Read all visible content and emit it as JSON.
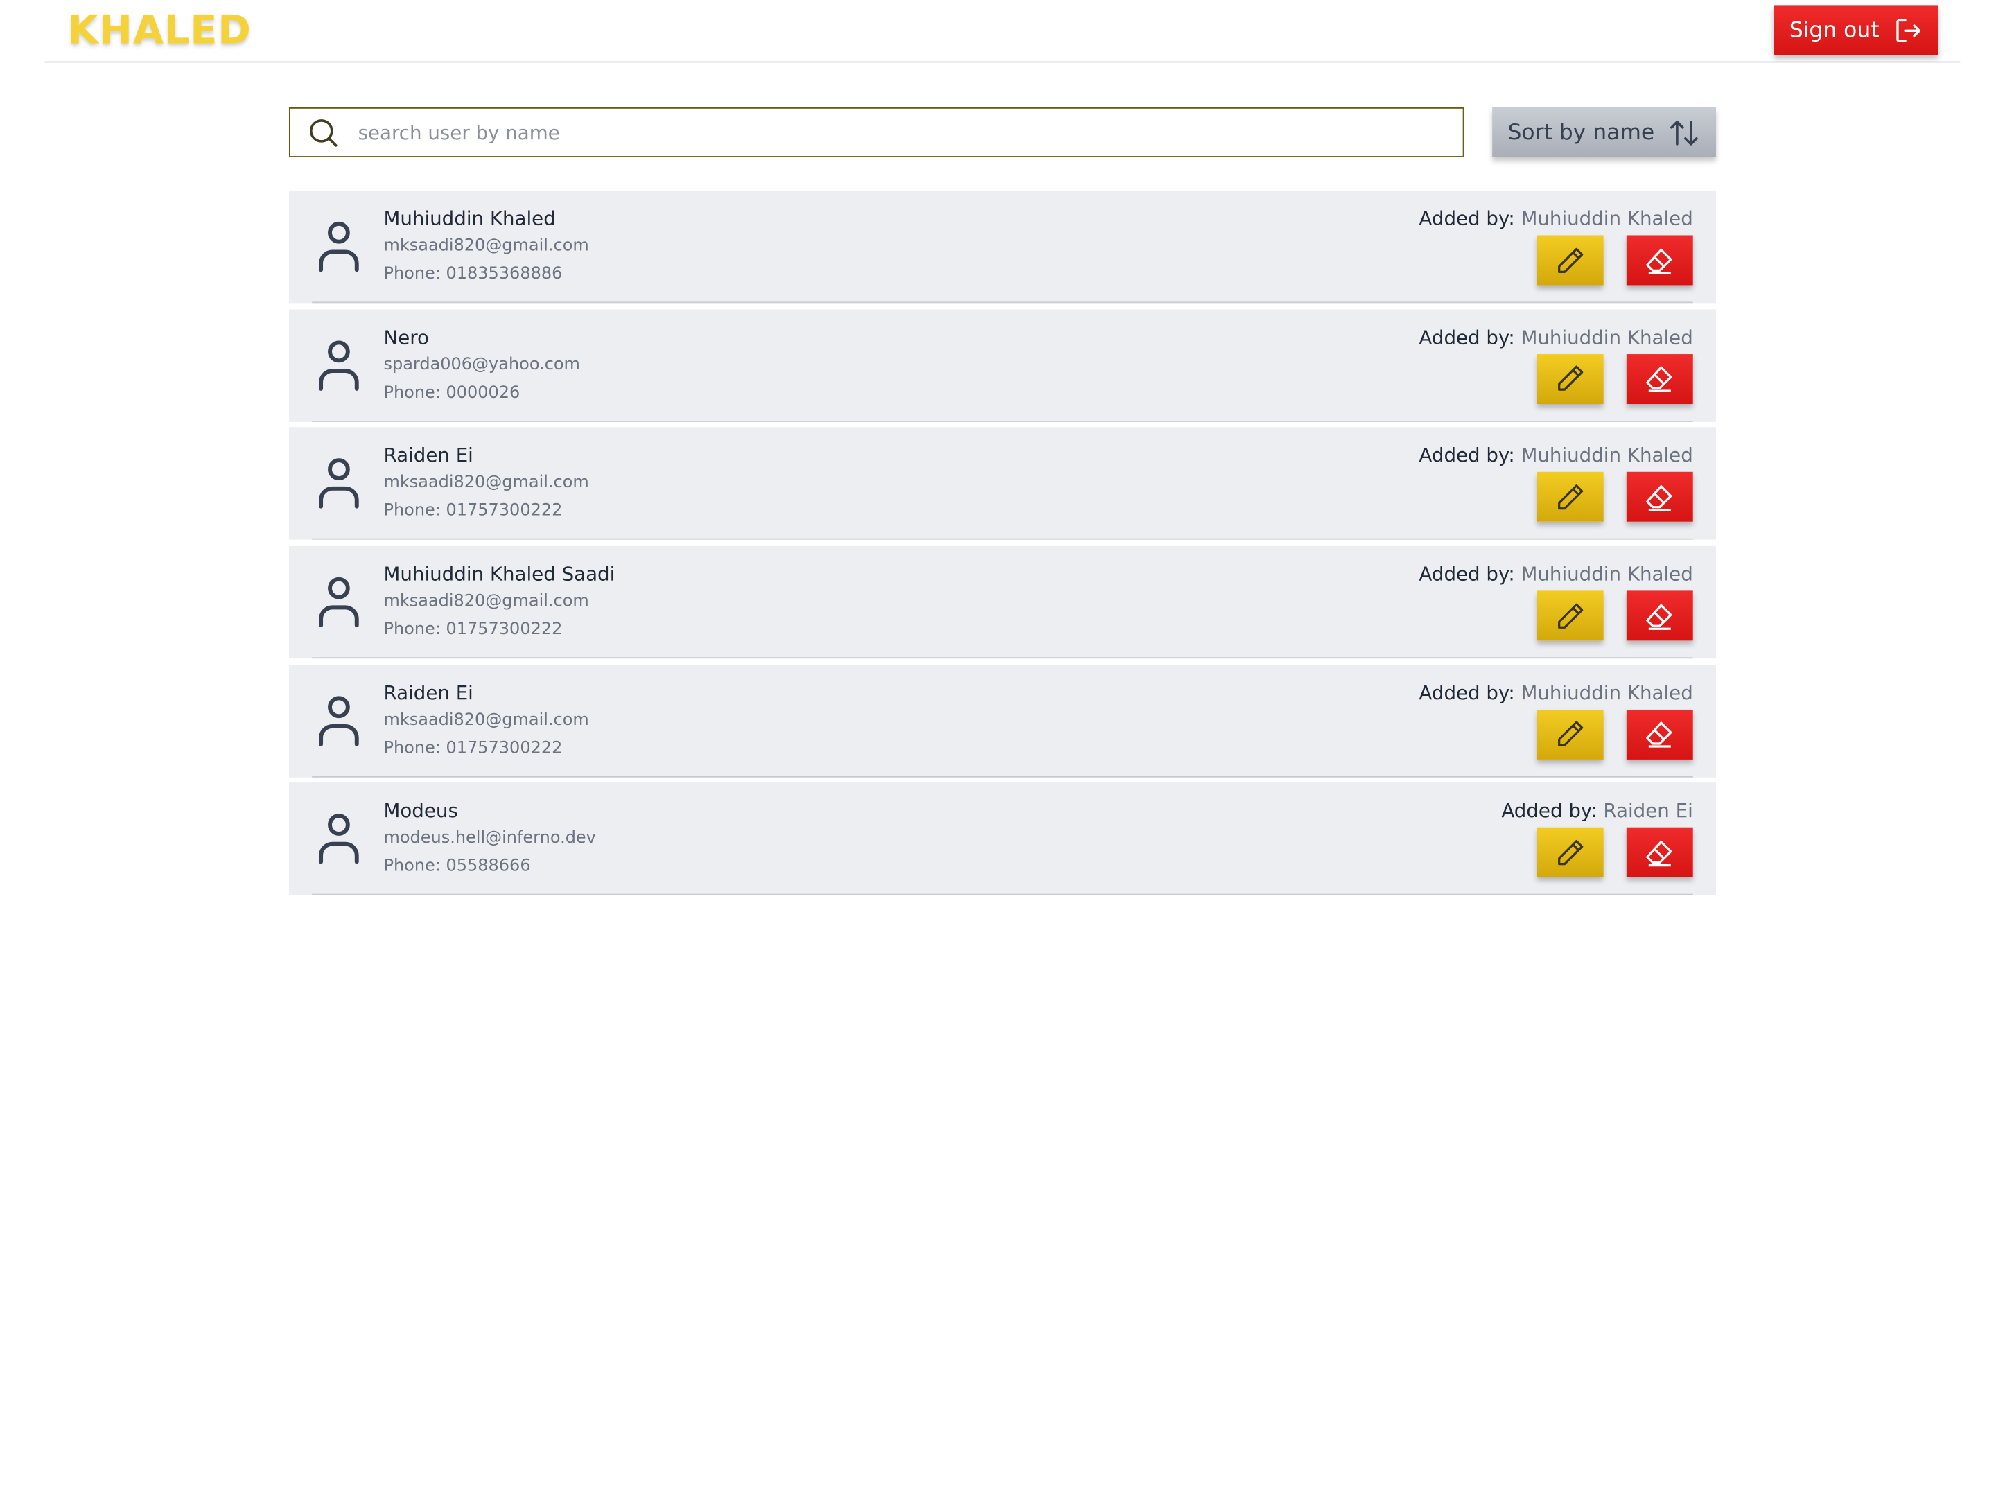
{
  "header": {
    "brand": "KHALED",
    "signout_label": "Sign out",
    "signout_icon": "logout-arrow-icon"
  },
  "search": {
    "placeholder": "search user by name",
    "value": "",
    "icon": "search-icon"
  },
  "sort": {
    "label": "Sort by name",
    "icon": "sort-arrows-icon"
  },
  "colors": {
    "brand": "#f5d23a",
    "danger": "#e11d1d",
    "edit": "#e6bb12",
    "card_bg": "#eceef1",
    "sort_bg": "#b9bec6"
  },
  "users": [
    {
      "name": "Muhiuddin Khaled",
      "email": "mksaadi820@gmail.com",
      "phone": "Phone: 01835368886",
      "added_label": "Added by:",
      "added_by": "Muhiuddin Khaled"
    },
    {
      "name": "Nero",
      "email": "sparda006@yahoo.com",
      "phone": "Phone: 0000026",
      "added_label": "Added by:",
      "added_by": "Muhiuddin Khaled"
    },
    {
      "name": "Raiden Ei",
      "email": "mksaadi820@gmail.com",
      "phone": "Phone: 01757300222",
      "added_label": "Added by:",
      "added_by": "Muhiuddin Khaled"
    },
    {
      "name": "Muhiuddin Khaled Saadi",
      "email": "mksaadi820@gmail.com",
      "phone": "Phone: 01757300222",
      "added_label": "Added by:",
      "added_by": "Muhiuddin Khaled"
    },
    {
      "name": "Raiden Ei",
      "email": "mksaadi820@gmail.com",
      "phone": "Phone: 01757300222",
      "added_label": "Added by:",
      "added_by": "Muhiuddin Khaled"
    },
    {
      "name": "Modeus",
      "email": "modeus.hell@inferno.dev",
      "phone": "Phone: 05588666",
      "added_label": "Added by:",
      "added_by": "Raiden Ei"
    }
  ]
}
